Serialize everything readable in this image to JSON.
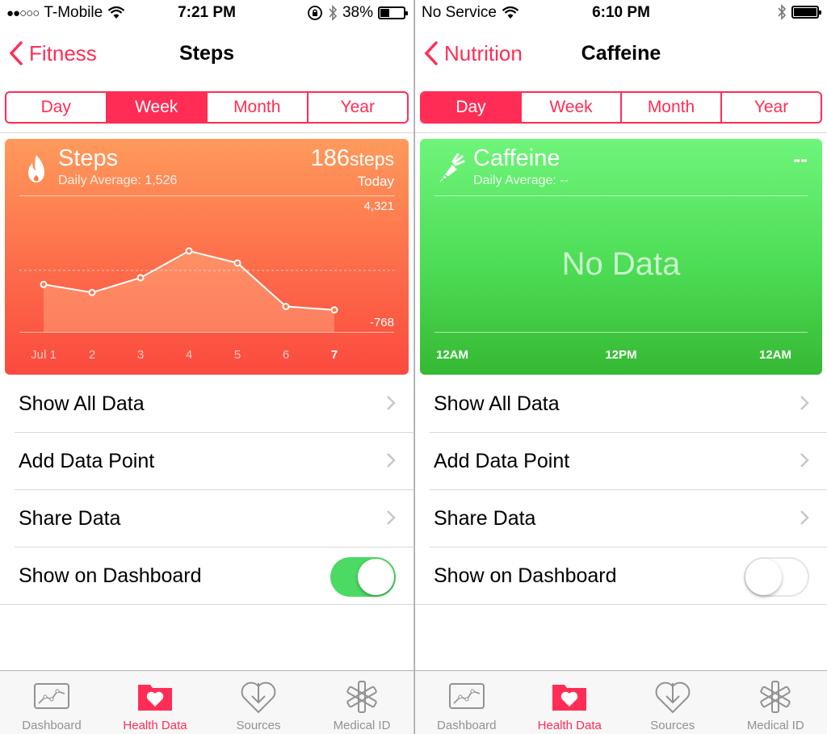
{
  "left": {
    "status": {
      "carrier": "T-Mobile",
      "time": "7:21 PM",
      "battery": "38%",
      "battery_level": 0.38
    },
    "nav": {
      "back_label": "Fitness",
      "title": "Steps"
    },
    "segments": [
      "Day",
      "Week",
      "Month",
      "Year"
    ],
    "selected_segment": "Week",
    "card": {
      "title": "Steps",
      "subtitle": "Daily Average: 1,526",
      "value": "186",
      "unit": "steps",
      "value_caption": "Today",
      "color_top": "#ff9a5c",
      "color_bottom": "#fb4a3e"
    },
    "chart_data": {
      "type": "line",
      "categories": [
        "Jul 1",
        "2",
        "3",
        "4",
        "5",
        "6",
        "7"
      ],
      "values": [
        1000,
        700,
        1250,
        2250,
        1800,
        180,
        50
      ],
      "ylim": [
        -768,
        4321
      ],
      "ytick_labels": [
        "4,321",
        "-768"
      ],
      "average": 1526,
      "highlight_category": "7"
    },
    "rows": [
      {
        "label": "Show All Data"
      },
      {
        "label": "Add Data Point"
      },
      {
        "label": "Share Data"
      }
    ],
    "dashboard_label": "Show on Dashboard",
    "dashboard_on": true
  },
  "right": {
    "status": {
      "carrier": "No Service",
      "time": "6:10 PM",
      "battery_level": 1.0
    },
    "nav": {
      "back_label": "Nutrition",
      "title": "Caffeine"
    },
    "segments": [
      "Day",
      "Week",
      "Month",
      "Year"
    ],
    "selected_segment": "Day",
    "card": {
      "title": "Caffeine",
      "subtitle": "Daily Average: --",
      "value": "--",
      "no_data": "No Data",
      "axis_labels": [
        "12AM",
        "12PM",
        "12AM"
      ],
      "color_top": "#6ef57a",
      "color_bottom": "#36b833"
    },
    "rows": [
      {
        "label": "Show All Data"
      },
      {
        "label": "Add Data Point"
      },
      {
        "label": "Share Data"
      }
    ],
    "dashboard_label": "Show on Dashboard",
    "dashboard_on": false
  },
  "tabs": [
    {
      "label": "Dashboard",
      "icon": "dashboard-icon"
    },
    {
      "label": "Health Data",
      "icon": "health-data-icon"
    },
    {
      "label": "Sources",
      "icon": "sources-icon"
    },
    {
      "label": "Medical ID",
      "icon": "medical-id-icon"
    }
  ],
  "active_tab": "Health Data",
  "accent": "#ff2d55",
  "toggle_on_color": "#4cd964"
}
